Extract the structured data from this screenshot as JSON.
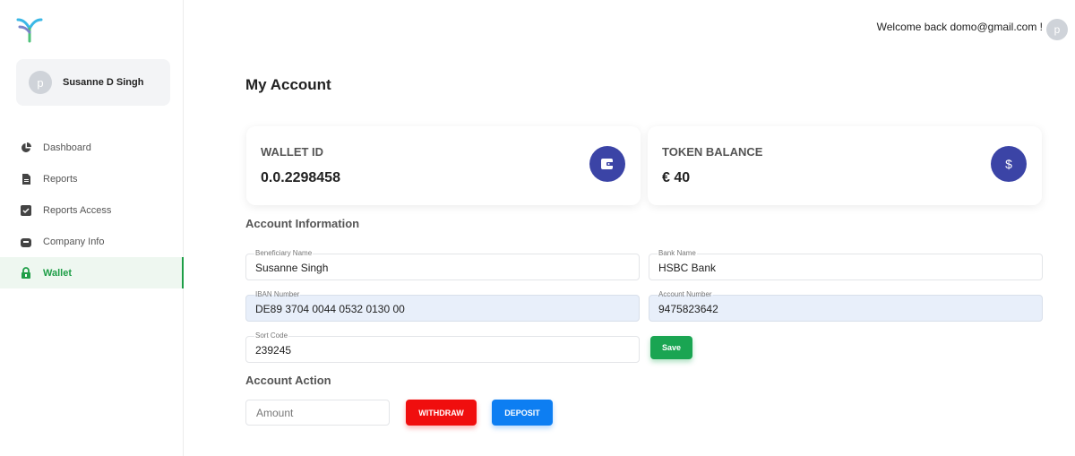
{
  "sidebar": {
    "profile": {
      "avatar_initial": "p",
      "name": "Susanne D Singh"
    },
    "items": [
      {
        "label": "Dashboard",
        "icon": "pie-chart-icon"
      },
      {
        "label": "Reports",
        "icon": "document-icon"
      },
      {
        "label": "Reports Access",
        "icon": "checkbox-icon"
      },
      {
        "label": "Company Info",
        "icon": "briefcase-icon"
      },
      {
        "label": "Wallet",
        "icon": "lock-icon",
        "active": true
      }
    ]
  },
  "header": {
    "welcome": "Welcome back domo@gmail.com !",
    "avatar_initial": "p"
  },
  "main": {
    "title": "My Account",
    "wallet_card": {
      "label": "WALLET ID",
      "value": "0.0.2298458",
      "icon": "wallet-icon"
    },
    "token_card": {
      "label": "TOKEN BALANCE",
      "value": "€ 40",
      "icon": "dollar-icon",
      "icon_glyph": "$"
    },
    "account_info": {
      "title": "Account Information",
      "beneficiary": {
        "label": "Beneficiary Name",
        "value": "Susanne Singh"
      },
      "bank": {
        "label": "Bank Name",
        "value": "HSBC Bank"
      },
      "iban": {
        "label": "IBAN Number",
        "value": "DE89 3704 0044 0532 0130 00"
      },
      "account_number": {
        "label": "Account Number",
        "value": "9475823642"
      },
      "sort_code": {
        "label": "Sort Code",
        "value": "239245"
      },
      "save_label": "Save"
    },
    "account_action": {
      "title": "Account Action",
      "amount_placeholder": "Amount",
      "withdraw_label": "WITHDRAW",
      "deposit_label": "DEPOSIT"
    }
  },
  "colors": {
    "accent_green": "#1aa552",
    "card_icon_bg": "#3b44a6",
    "withdraw_red": "#f00e0e",
    "deposit_blue": "#0d7ef2",
    "filled_field_bg": "#e8effa"
  }
}
